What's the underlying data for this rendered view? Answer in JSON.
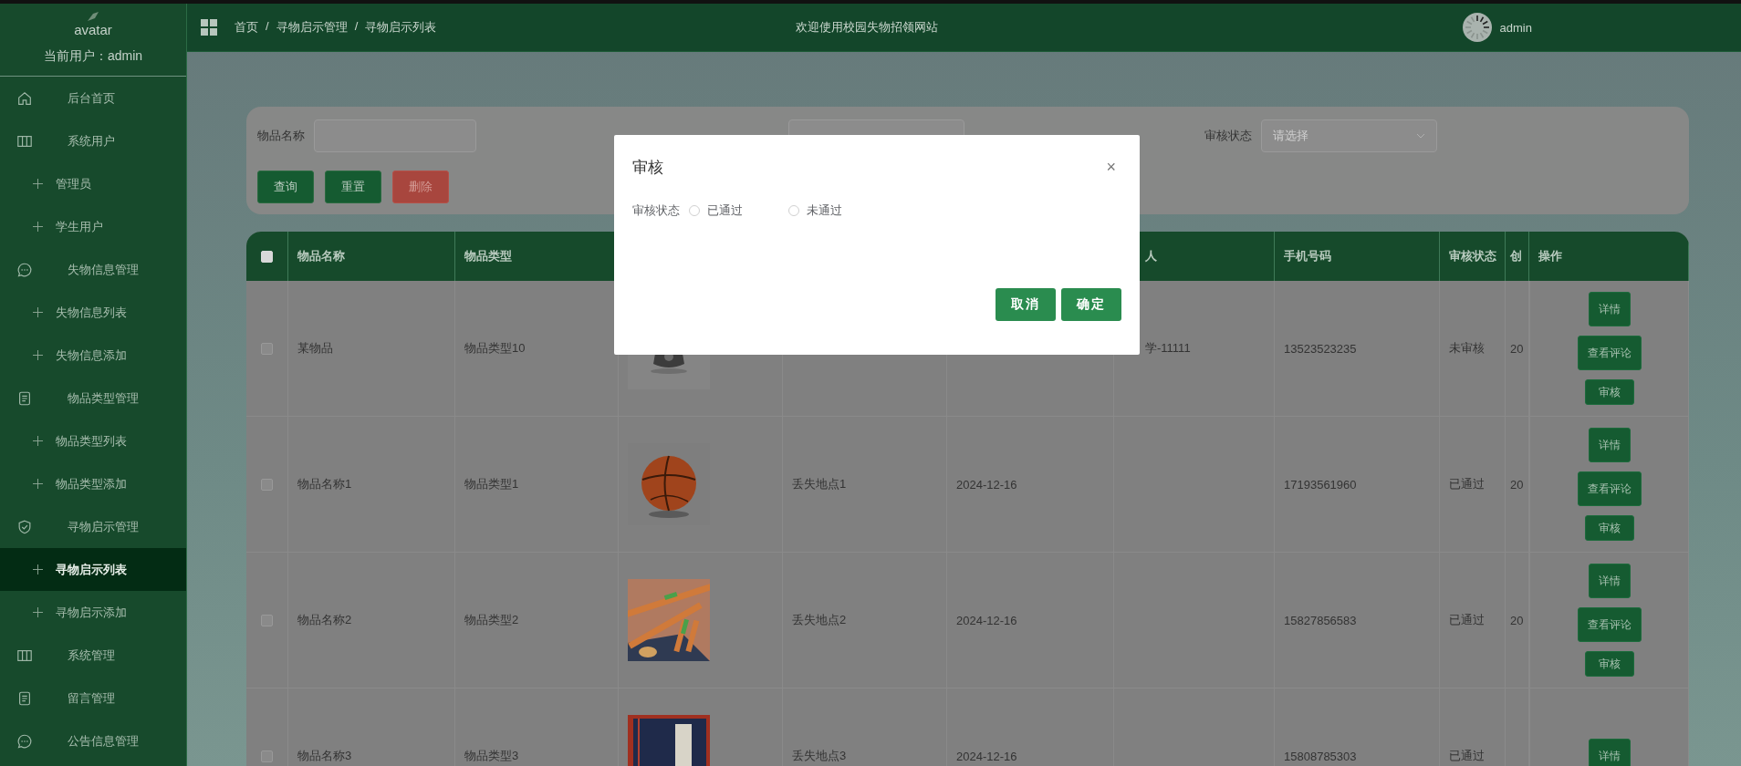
{
  "sidebar": {
    "avatar_alt": "avatar",
    "current_user": "当前用户：admin",
    "items": [
      {
        "kind": "top",
        "label": "后台首页",
        "selected": false
      },
      {
        "kind": "top",
        "label": "系统用户",
        "selected": false
      },
      {
        "kind": "sub",
        "label": "管理员",
        "selected": false
      },
      {
        "kind": "sub",
        "label": "学生用户",
        "selected": false
      },
      {
        "kind": "top",
        "label": "失物信息管理",
        "selected": false
      },
      {
        "kind": "sub",
        "label": "失物信息列表",
        "selected": false
      },
      {
        "kind": "sub",
        "label": "失物信息添加",
        "selected": false
      },
      {
        "kind": "top",
        "label": "物品类型管理",
        "selected": false
      },
      {
        "kind": "sub",
        "label": "物品类型列表",
        "selected": false
      },
      {
        "kind": "sub",
        "label": "物品类型添加",
        "selected": false
      },
      {
        "kind": "top",
        "label": "寻物启示管理",
        "selected": false
      },
      {
        "kind": "sub",
        "label": "寻物启示列表",
        "selected": true
      },
      {
        "kind": "sub",
        "label": "寻物启示添加",
        "selected": false
      },
      {
        "kind": "top",
        "label": "系统管理",
        "selected": false
      },
      {
        "kind": "top",
        "label": "留言管理",
        "selected": false
      },
      {
        "kind": "top",
        "label": "公告信息管理",
        "selected": false
      }
    ]
  },
  "header": {
    "breadcrumb": [
      "首页",
      "/",
      "寻物启示管理",
      "/",
      "寻物启示列表"
    ],
    "title": "欢迎使用校园失物招领网站",
    "user": "admin"
  },
  "filters": [
    {
      "kind": "input",
      "label": "物品名称"
    },
    {
      "kind": "select"
    },
    {
      "kind": "select",
      "label": "审核状态",
      "placeholder": "请选择"
    }
  ],
  "filter_buttons": [
    {
      "kind": "primary",
      "label": "查询"
    },
    {
      "kind": "primary",
      "label": "重置"
    },
    {
      "kind": "danger",
      "label": "删除"
    }
  ],
  "table": {
    "header_checked": false,
    "columns": [
      "物品名称",
      "物品类型",
      "",
      "",
      "",
      "人",
      "手机号码",
      "审核状态",
      "创",
      "操作"
    ],
    "rows": [
      {
        "checked": false,
        "cells": [
          "某物品",
          "物品类型10",
          "",
          "",
          "",
          "学-11111",
          "13523523235",
          "未审核",
          "20"
        ],
        "actions": [
          "详情",
          "查看评论",
          "审核"
        ]
      },
      {
        "checked": false,
        "cells": [
          "物品名称1",
          "物品类型1",
          "",
          "丢失地点1",
          "2024-12-16",
          "",
          "17193561960",
          "已通过",
          "20"
        ],
        "actions": [
          "详情",
          "查看评论",
          "审核"
        ]
      },
      {
        "checked": false,
        "cells": [
          "物品名称2",
          "物品类型2",
          "",
          "丢失地点2",
          "2024-12-16",
          "",
          "15827856583",
          "已通过",
          "20"
        ],
        "actions": [
          "详情",
          "查看评论",
          "审核"
        ]
      },
      {
        "checked": false,
        "cells": [
          "物品名称3",
          "物品类型3",
          "",
          "丢失地点3",
          "2024-12-16",
          "",
          "15808785303",
          "已通过",
          ""
        ],
        "actions": [
          "详情"
        ]
      }
    ]
  },
  "dialog": {
    "title": "审核",
    "close": "×",
    "field_label": "审核状态",
    "options": [
      {
        "label": "已通过",
        "selected": false
      },
      {
        "label": "未通过",
        "selected": false
      }
    ],
    "buttons": [
      "取消",
      "确定"
    ]
  }
}
